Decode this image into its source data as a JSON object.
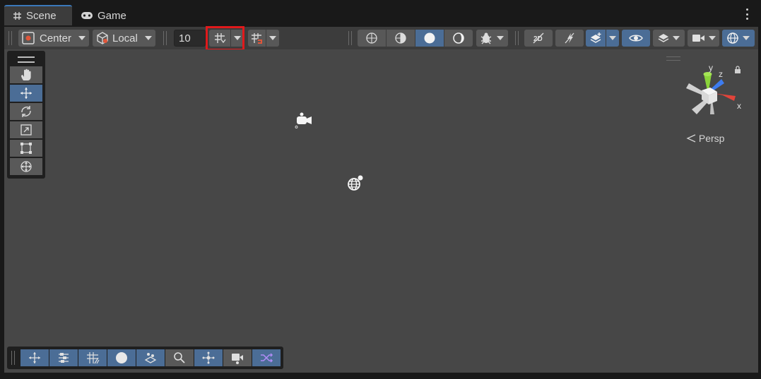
{
  "tabs": [
    {
      "label": "Scene",
      "icon": "grid-icon",
      "active": true
    },
    {
      "label": "Game",
      "icon": "gamepad-icon",
      "active": false
    }
  ],
  "toolbar": {
    "pivot_label": "Center",
    "space_label": "Local",
    "grid_size_value": "10"
  },
  "gizmo": {
    "axis_y": "y",
    "axis_z": "z",
    "axis_x": "x",
    "projection_label": "Persp"
  },
  "colors": {
    "accent_blue": "#4b6d96",
    "highlight_red": "#e0191b",
    "viewport_bg": "#474747",
    "axis_y": "#8ad33a",
    "axis_z": "#3d7cf0",
    "axis_x": "#e2443a"
  }
}
